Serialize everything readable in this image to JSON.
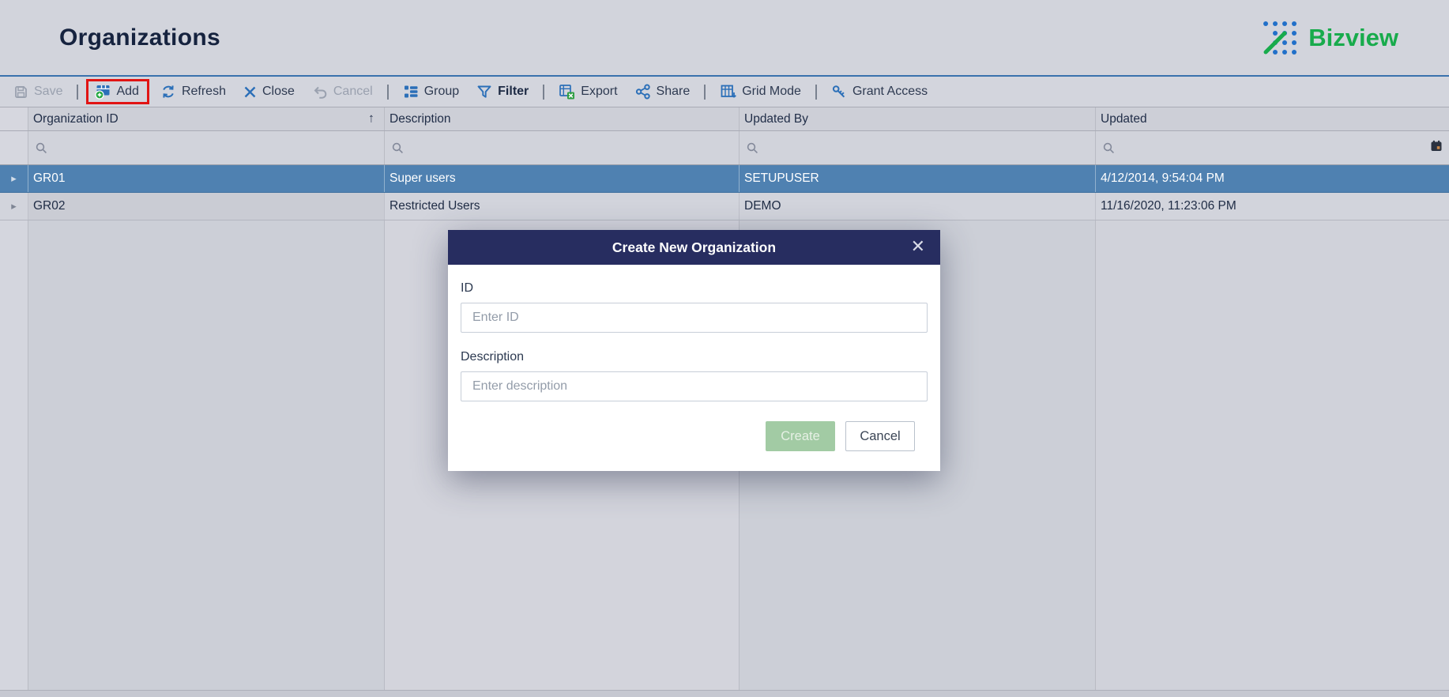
{
  "page": {
    "title": "Organizations"
  },
  "brand": {
    "name": "Bizview"
  },
  "toolbar": {
    "items": [
      {
        "label": "Save",
        "icon": "save-icon",
        "state": "disabled"
      },
      {
        "label": "Add",
        "icon": "add-icon",
        "state": "highlighted-red"
      },
      {
        "label": "Refresh",
        "icon": "refresh-icon",
        "state": "normal"
      },
      {
        "label": "Close",
        "icon": "close-icon",
        "state": "normal"
      },
      {
        "label": "Cancel",
        "icon": "cancel-icon",
        "state": "disabled"
      },
      {
        "label": "Group",
        "icon": "group-icon",
        "state": "normal"
      },
      {
        "label": "Filter",
        "icon": "filter-icon",
        "state": "active-bold"
      },
      {
        "label": "Export",
        "icon": "export-icon",
        "state": "normal"
      },
      {
        "label": "Share",
        "icon": "share-icon",
        "state": "normal"
      },
      {
        "label": "Grid Mode",
        "icon": "grid-mode-icon",
        "state": "normal"
      },
      {
        "label": "Grant Access",
        "icon": "grant-access-icon",
        "state": "normal"
      }
    ]
  },
  "grid": {
    "columns": [
      {
        "label": "Organization ID",
        "sorted": "ascending"
      },
      {
        "label": "Description"
      },
      {
        "label": "Updated By"
      },
      {
        "label": "Updated"
      }
    ],
    "rows": [
      {
        "id": "GR01",
        "description": "Super users",
        "updated_by": "SETUPUSER",
        "updated": "4/12/2014, 9:54:04 PM",
        "selected": true
      },
      {
        "id": "GR02",
        "description": "Restricted Users",
        "updated_by": "DEMO",
        "updated": "11/16/2020, 11:23:06 PM",
        "selected": false
      }
    ]
  },
  "modal": {
    "title": "Create New Organization",
    "close_glyph": "✕",
    "fields": [
      {
        "label": "ID",
        "placeholder": "Enter ID",
        "value": ""
      },
      {
        "label": "Description",
        "placeholder": "Enter description",
        "value": ""
      }
    ],
    "buttons": {
      "create": "Create",
      "cancel": "Cancel"
    }
  },
  "icons": {
    "sort_ascending": "↑",
    "row_expander": "▸"
  },
  "colors": {
    "highlight_red": "#e11414",
    "selected_row_blue": "#4f81b1",
    "modal_header_navy": "#272d60",
    "toolbar_icon_blue": "#2b6fb8",
    "brand_green": "#18ab4c",
    "brand_blue": "#2170c9",
    "create_button_green": "#a2cba4",
    "page_background": "#d2d4dc"
  }
}
